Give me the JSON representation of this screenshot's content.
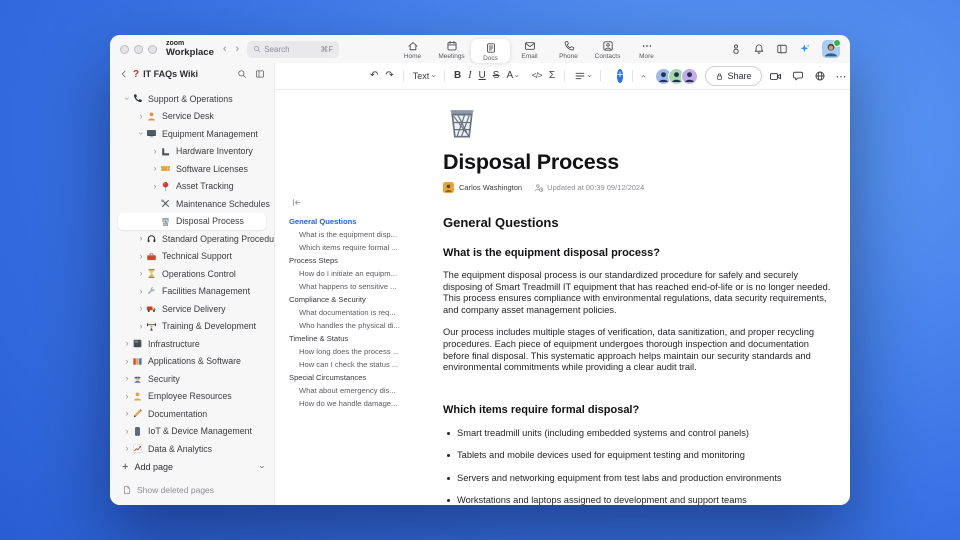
{
  "colors": {
    "accent": "#2470f0",
    "outline_active": "#2160f3",
    "sparkle": "#2d8cff"
  },
  "window": {
    "brand_top": "zoom",
    "brand_bottom": "Workplace",
    "search": {
      "placeholder": "Search",
      "shortcut": "⌘F"
    },
    "tabs": [
      {
        "label": "Home",
        "icon": "home",
        "active": false
      },
      {
        "label": "Meetings",
        "icon": "calendar",
        "active": false
      },
      {
        "label": "Docs",
        "icon": "docicon",
        "active": true
      },
      {
        "label": "Email",
        "icon": "mail",
        "active": false
      },
      {
        "label": "Phone",
        "icon": "phonetab",
        "active": false
      },
      {
        "label": "Contacts",
        "icon": "contacts",
        "active": false
      },
      {
        "label": "More",
        "icon": "more",
        "active": false
      }
    ]
  },
  "sidebar": {
    "title": "IT FAQs Wiki",
    "badge": "?",
    "items": [
      {
        "label": "Support & Operations",
        "icon": "phoneblack",
        "level": 0,
        "expander": "down",
        "selected": false
      },
      {
        "label": "Service Desk",
        "icon": "personorange",
        "level": 1,
        "expander": "right",
        "selected": false
      },
      {
        "label": "Equipment Management",
        "icon": "monitor",
        "level": 1,
        "expander": "down",
        "selected": false
      },
      {
        "label": "Hardware Inventory",
        "icon": "arm",
        "level": 2,
        "expander": "right",
        "selected": false
      },
      {
        "label": "Software Licenses",
        "icon": "ticket",
        "level": 2,
        "expander": "right",
        "selected": false
      },
      {
        "label": "Asset Tracking",
        "icon": "pin",
        "level": 2,
        "expander": "right",
        "selected": false
      },
      {
        "label": "Maintenance Schedules",
        "icon": "tools",
        "level": 2,
        "expander": "none",
        "selected": false
      },
      {
        "label": "Disposal Process",
        "icon": "trash",
        "level": 2,
        "expander": "none",
        "selected": true
      },
      {
        "label": "Standard Operating Procedures",
        "icon": "headset",
        "level": 1,
        "expander": "right",
        "selected": false
      },
      {
        "label": "Technical Support",
        "icon": "toolbox",
        "level": 1,
        "expander": "right",
        "selected": false
      },
      {
        "label": "Operations Control",
        "icon": "hourglass",
        "level": 1,
        "expander": "right",
        "selected": false
      },
      {
        "label": "Facilities Management",
        "icon": "wrench",
        "level": 1,
        "expander": "right",
        "selected": false
      },
      {
        "label": "Service Delivery",
        "icon": "truck",
        "level": 1,
        "expander": "right",
        "selected": false
      },
      {
        "label": "Training & Development",
        "icon": "weights",
        "level": 1,
        "expander": "right",
        "selected": false
      },
      {
        "label": "Infrastructure",
        "icon": "server",
        "level": 0,
        "expander": "right",
        "selected": false
      },
      {
        "label": "Applications & Software",
        "icon": "books",
        "level": 0,
        "expander": "right",
        "selected": false
      },
      {
        "label": "Security",
        "icon": "police",
        "level": 0,
        "expander": "right",
        "selected": false
      },
      {
        "label": "Employee Resources",
        "icon": "personamber",
        "level": 0,
        "expander": "right",
        "selected": false
      },
      {
        "label": "Documentation",
        "icon": "pencil",
        "level": 0,
        "expander": "right",
        "selected": false
      },
      {
        "label": "IoT & Device Management",
        "icon": "mobile",
        "level": 0,
        "expander": "right",
        "selected": false
      },
      {
        "label": "Data & Analytics",
        "icon": "chart",
        "level": 0,
        "expander": "right",
        "selected": false
      }
    ],
    "add_page": "Add page",
    "show_deleted": "Show deleted pages"
  },
  "toolbar": {
    "undo": "↶",
    "redo": "↷",
    "style_dropdown": "Text",
    "bold": "B",
    "italic": "I",
    "underline": "U",
    "strikethrough": "S",
    "color": "A",
    "code": "</>",
    "formula": "Σ",
    "share": "Share",
    "more": "⋯"
  },
  "outline": {
    "items": [
      {
        "label": "General Questions",
        "type": "section",
        "active": true
      },
      {
        "label": "What is the equipment disp...",
        "type": "sub",
        "active": false
      },
      {
        "label": "Which items require formal ...",
        "type": "sub",
        "active": false
      },
      {
        "label": "Process Steps",
        "type": "section",
        "active": false
      },
      {
        "label": "How do I initiate an equipm...",
        "type": "sub",
        "active": false
      },
      {
        "label": "What happens to sensitive ...",
        "type": "sub",
        "active": false
      },
      {
        "label": "Compliance & Security",
        "type": "section",
        "active": false
      },
      {
        "label": "What documentation is req...",
        "type": "sub",
        "active": false
      },
      {
        "label": "Who handles the physical di...",
        "type": "sub",
        "active": false
      },
      {
        "label": "Timeline & Status",
        "type": "section",
        "active": false
      },
      {
        "label": "How long does the process ...",
        "type": "sub",
        "active": false
      },
      {
        "label": "How can I check the status ...",
        "type": "sub",
        "active": false
      },
      {
        "label": "Special Circumstances",
        "type": "section",
        "active": false
      },
      {
        "label": "What about emergency dis...",
        "type": "sub",
        "active": false
      },
      {
        "label": "How do we handle damage...",
        "type": "sub",
        "active": false
      }
    ]
  },
  "document": {
    "title": "Disposal Process",
    "author": "Carlos Washington",
    "updated": "Updated at 00:39 09/12/2024",
    "section_heading": "General Questions",
    "q1": {
      "heading": "What is the equipment disposal process?",
      "p1": "The equipment disposal process is our standardized procedure for safely and securely disposing of Smart Treadmill IT equipment that has reached end-of-life or is no longer needed. This process ensures compliance with environmental regulations, data security requirements, and company asset management policies.",
      "p2": "Our process includes multiple stages of verification, data sanitization, and proper recycling procedures. Each piece of equipment undergoes thorough inspection and documentation before final disposal. This systematic approach helps maintain our security standards and environmental commitments while providing a clear audit trail."
    },
    "q2": {
      "heading": "Which items require formal disposal?",
      "bullets": [
        "Smart treadmill units (including embedded systems and control panels)",
        "Tablets and mobile devices used for equipment testing and monitoring",
        "Servers and networking equipment from test labs and production environments",
        "Workstations and laptops assigned to development and support teams"
      ]
    }
  }
}
